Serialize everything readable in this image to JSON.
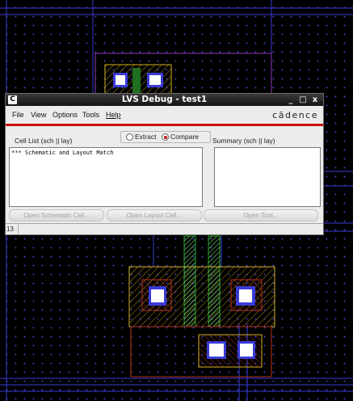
{
  "dialog": {
    "title": "LVS Debug - test1",
    "logo_glyph": "C",
    "window_controls": {
      "minimize": "_",
      "maximize": "□",
      "close": "x"
    },
    "menu": [
      "File",
      "View",
      "Options",
      "Tools",
      "Help"
    ],
    "brand": "cādence",
    "cell_list": {
      "label": "Cell List (sch || lay)",
      "text": "*** Schematic and Layout Match"
    },
    "mode": {
      "options": [
        "Extract",
        "Compare"
      ],
      "selected": "Compare"
    },
    "summary": {
      "label": "Summary (sch || lay)"
    },
    "buttons": {
      "open_schematic": "Open Schematic Cell...",
      "open_layout": "Open Layout Cell...",
      "open_tool": "Open Tool..."
    },
    "status": {
      "count": "13"
    }
  },
  "colors": {
    "background": "#000000",
    "grid_dot": "#4a4ad0",
    "metal1_blue": "#3b3bd6",
    "poly_green": "#2aa82a",
    "active_yellow": "#d4b21f",
    "nwell_red": "#b8321c",
    "contact_white": "#ffffff",
    "pselect_magenta": "#8a3ab8",
    "accent_red": "#cc1111"
  }
}
